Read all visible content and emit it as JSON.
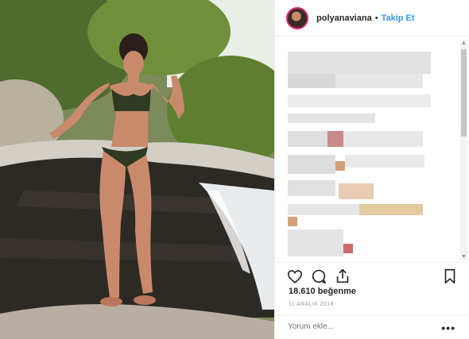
{
  "header": {
    "username": "polyanaviana",
    "separator": "•",
    "follow_label": "Takip Et"
  },
  "comments": {
    "note": ""
  },
  "stats": {
    "likes": "18.610 beğenme",
    "date": "11 ARALIK 2018"
  },
  "comment_box": {
    "placeholder": "Yorum ekle..."
  },
  "icons": {
    "like": "heart-icon",
    "comment": "comment-icon",
    "share": "share-icon",
    "save": "bookmark-icon",
    "more": "more-icon"
  },
  "colors": {
    "follow": "#3897f0",
    "story_ring": "#d62976",
    "text": "#262626",
    "muted": "#999999"
  }
}
